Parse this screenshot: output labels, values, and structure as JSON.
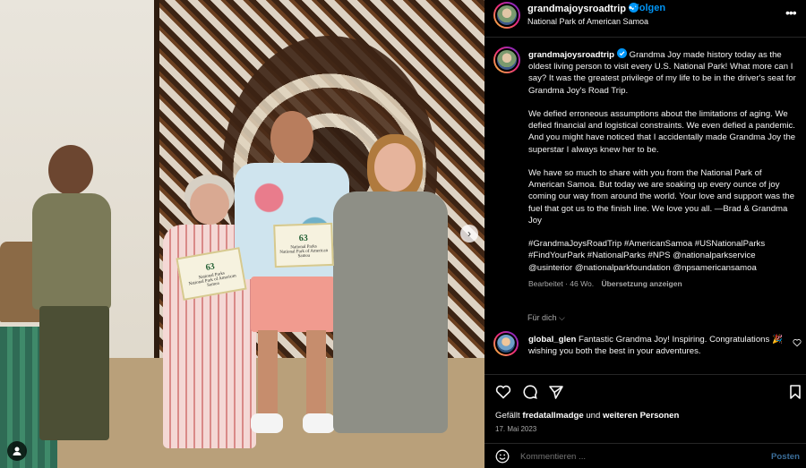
{
  "post": {
    "username": "grandmajoysroadtrip",
    "follow_label": "Folgen",
    "separator": "•",
    "location": "National Park of American Samoa",
    "more_label": "•••"
  },
  "photo": {
    "cert_left": {
      "number": "63",
      "line1": "National Parks",
      "line2": "National Park of American Samoa"
    },
    "cert_right": {
      "number": "63",
      "line1": "National Parks",
      "line2": "National Park of American Samoa"
    },
    "next_label": "›"
  },
  "caption": {
    "username": "grandmajoysroadtrip",
    "p1": "Grandma Joy made history today as the oldest living person to visit every U.S. National Park! What more can I say? It was the greatest privilege of my life to be in the driver's seat for Grandma Joy's Road Trip.",
    "p2": "We defied erroneous assumptions about the limitations of aging. We defied financial and logistical constraints. We even defied a pandemic. And you might have noticed that I accidentally made Grandma Joy the superstar I always knew her to be.",
    "p3": "We have so much to share with you from the National Park of American Samoa. But today we are soaking up every ounce of joy coming our way from around the world. Your love and support was the fuel that got us to the finish line. We love you all. —Brad & Grandma Joy",
    "p4": "#GrandmaJoysRoadTrip #AmericanSamoa #USNationalParks #FindYourPark #NationalParks #NPS @nationalparkservice @usinterior @nationalparkfoundation @npsamericansamoa",
    "edited": "Bearbeitet · 46 Wo.",
    "translate": "Übersetzung anzeigen"
  },
  "for_you": "Für dich ⌵",
  "comment": {
    "username": "global_glen",
    "text": "Fantastic Grandma Joy! Inspiring. Congratulations 🎉 wishing you both the best in your adventures."
  },
  "actions": {
    "likes_prefix": "Gefällt",
    "likes_user": "fredatallmadge",
    "likes_middle": "und",
    "likes_others": "weiteren Personen",
    "date": "17. Mai 2023",
    "comment_placeholder": "Kommentieren ...",
    "post_label": "Posten"
  },
  "colors": {
    "accent": "#0095f6",
    "background": "#000000",
    "muted": "#a8a8a8"
  }
}
